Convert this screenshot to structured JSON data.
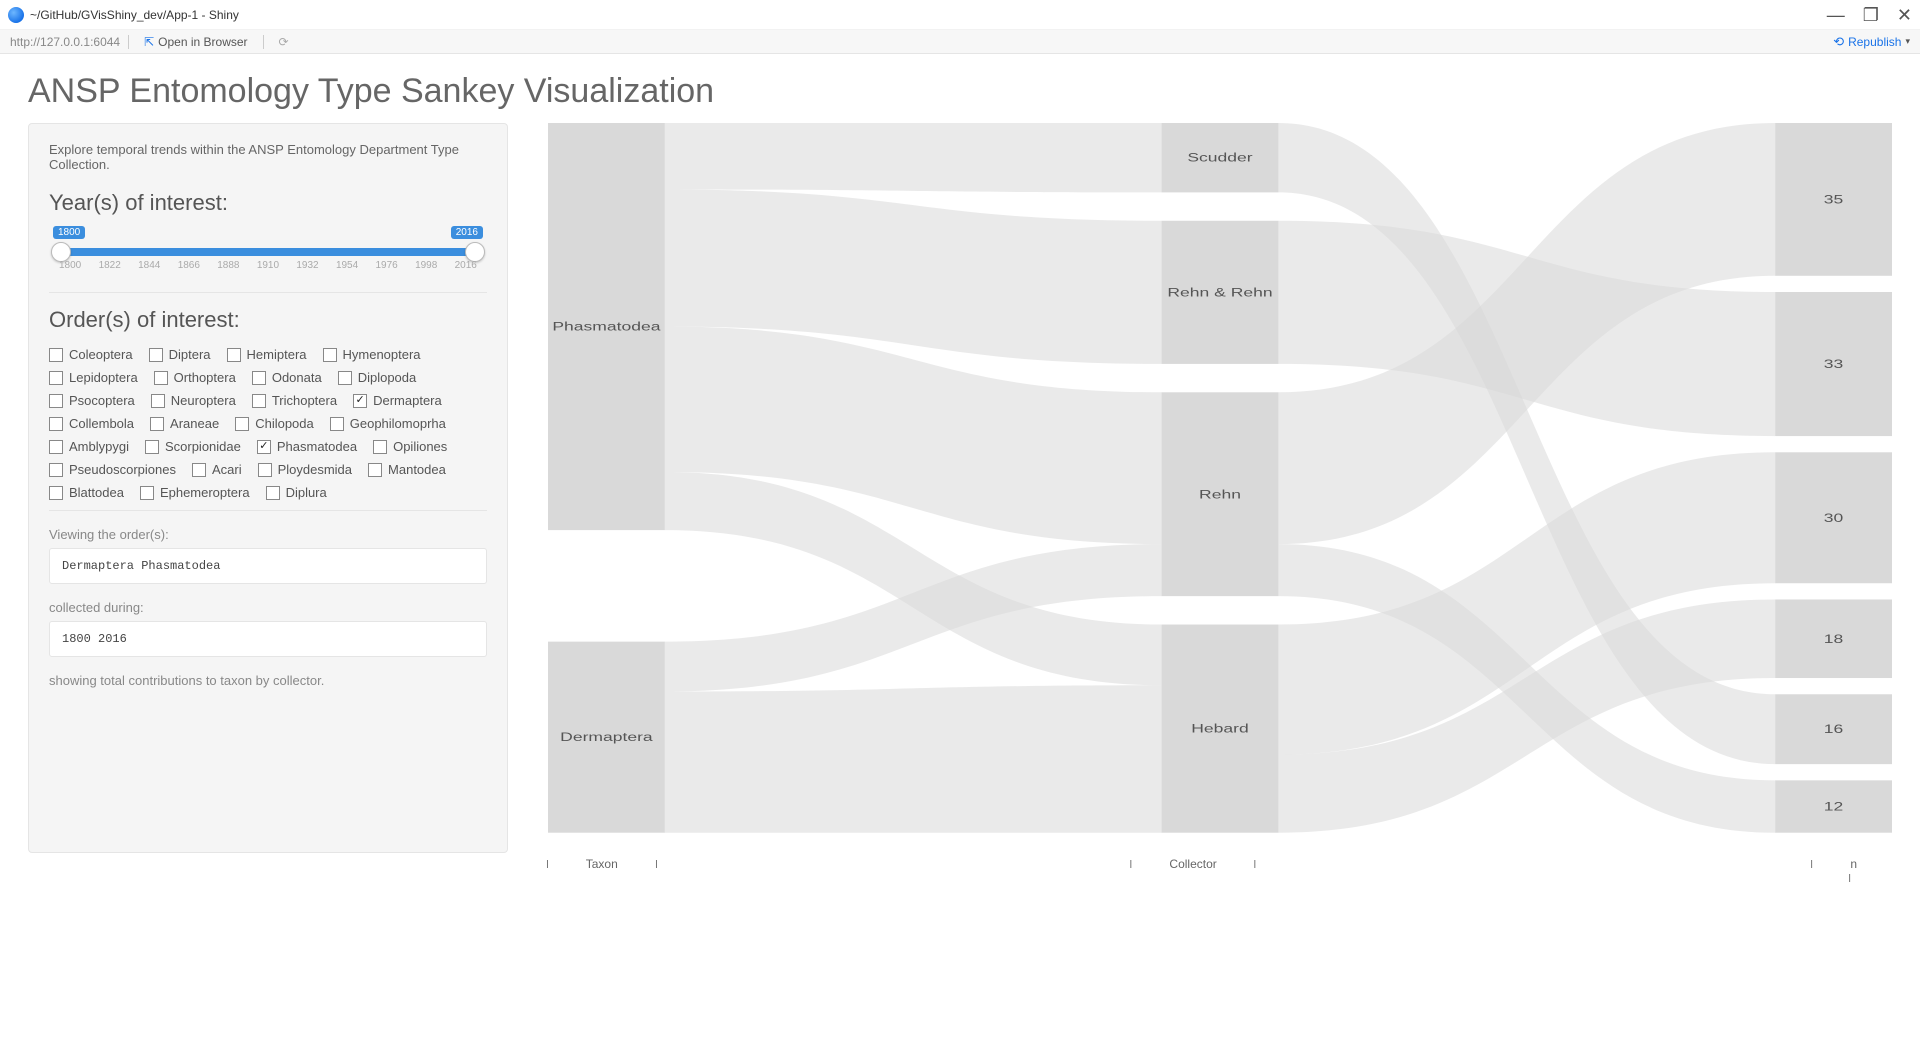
{
  "window": {
    "title": "~/GitHub/GVisShiny_dev/App-1 - Shiny",
    "url": "http://127.0.0.1:6044",
    "open_in_browser": "Open in Browser",
    "republish": "Republish"
  },
  "page": {
    "title": "ANSP Entomology Type Sankey Visualization"
  },
  "sidebar": {
    "intro": "Explore temporal trends within the ANSP Entomology Department Type Collection.",
    "year_head": "Year(s) of interest:",
    "slider": {
      "min": 1800,
      "max": 2016,
      "from": 1800,
      "to": 2016,
      "ticks": [
        "1800",
        "1822",
        "1844",
        "1866",
        "1888",
        "1910",
        "1932",
        "1954",
        "1976",
        "1998",
        "2016"
      ]
    },
    "order_head": "Order(s) of interest:",
    "orders": [
      {
        "label": "Coleoptera",
        "checked": false
      },
      {
        "label": "Diptera",
        "checked": false
      },
      {
        "label": "Hemiptera",
        "checked": false
      },
      {
        "label": "Hymenoptera",
        "checked": false
      },
      {
        "label": "Lepidoptera",
        "checked": false
      },
      {
        "label": "Orthoptera",
        "checked": false
      },
      {
        "label": "Odonata",
        "checked": false
      },
      {
        "label": "Diplopoda",
        "checked": false
      },
      {
        "label": "Psocoptera",
        "checked": false
      },
      {
        "label": "Neuroptera",
        "checked": false
      },
      {
        "label": "Trichoptera",
        "checked": false
      },
      {
        "label": "Dermaptera",
        "checked": true
      },
      {
        "label": "Collembola",
        "checked": false
      },
      {
        "label": "Araneae",
        "checked": false
      },
      {
        "label": "Chilopoda",
        "checked": false
      },
      {
        "label": "Geophilomoprha",
        "checked": false
      },
      {
        "label": "Amblypygi",
        "checked": false
      },
      {
        "label": "Scorpionidae",
        "checked": false
      },
      {
        "label": "Phasmatodea",
        "checked": true
      },
      {
        "label": "Opiliones",
        "checked": false
      },
      {
        "label": "Pseudoscorpiones",
        "checked": false
      },
      {
        "label": "Acari",
        "checked": false
      },
      {
        "label": "Ploydesmida",
        "checked": false
      },
      {
        "label": "Mantodea",
        "checked": false
      },
      {
        "label": "Blattodea",
        "checked": false
      },
      {
        "label": "Ephemeroptera",
        "checked": false
      },
      {
        "label": "Diplura",
        "checked": false
      }
    ],
    "viewing_label": "Viewing the order(s):",
    "viewing_value": "Dermaptera Phasmatodea",
    "collected_label": "collected during:",
    "collected_value": "1800 2016",
    "summary": "showing total contributions to taxon by collector."
  },
  "chart_data": {
    "type": "sankey",
    "axis_labels": [
      "Taxon",
      "Collector",
      "n"
    ],
    "nodes": {
      "taxon": [
        {
          "name": "Phasmatodea",
          "value": 98
        },
        {
          "name": "Dermaptera",
          "value": 46
        }
      ],
      "collector": [
        {
          "name": "Scudder",
          "value": 16
        },
        {
          "name": "Rehn & Rehn",
          "value": 33
        },
        {
          "name": "Rehn",
          "value": 47
        },
        {
          "name": "Hebard",
          "value": 48
        }
      ],
      "n": [
        {
          "name": "35",
          "value": 35
        },
        {
          "name": "33",
          "value": 33
        },
        {
          "name": "30",
          "value": 30
        },
        {
          "name": "18",
          "value": 18
        },
        {
          "name": "16",
          "value": 16
        },
        {
          "name": "12",
          "value": 12
        }
      ]
    },
    "links_taxon_collector": [
      {
        "source": "Phasmatodea",
        "target": "Scudder",
        "value": 16
      },
      {
        "source": "Phasmatodea",
        "target": "Rehn & Rehn",
        "value": 33
      },
      {
        "source": "Phasmatodea",
        "target": "Rehn",
        "value": 35
      },
      {
        "source": "Phasmatodea",
        "target": "Hebard",
        "value": 14
      },
      {
        "source": "Dermaptera",
        "target": "Rehn",
        "value": 12
      },
      {
        "source": "Dermaptera",
        "target": "Hebard",
        "value": 34
      }
    ],
    "links_collector_n": [
      {
        "source": "Scudder",
        "target": "16",
        "value": 16
      },
      {
        "source": "Rehn & Rehn",
        "target": "33",
        "value": 33
      },
      {
        "source": "Rehn",
        "target": "35",
        "value": 35
      },
      {
        "source": "Rehn",
        "target": "12",
        "value": 12
      },
      {
        "source": "Hebard",
        "target": "30",
        "value": 30
      },
      {
        "source": "Hebard",
        "target": "18",
        "value": 18
      }
    ]
  }
}
